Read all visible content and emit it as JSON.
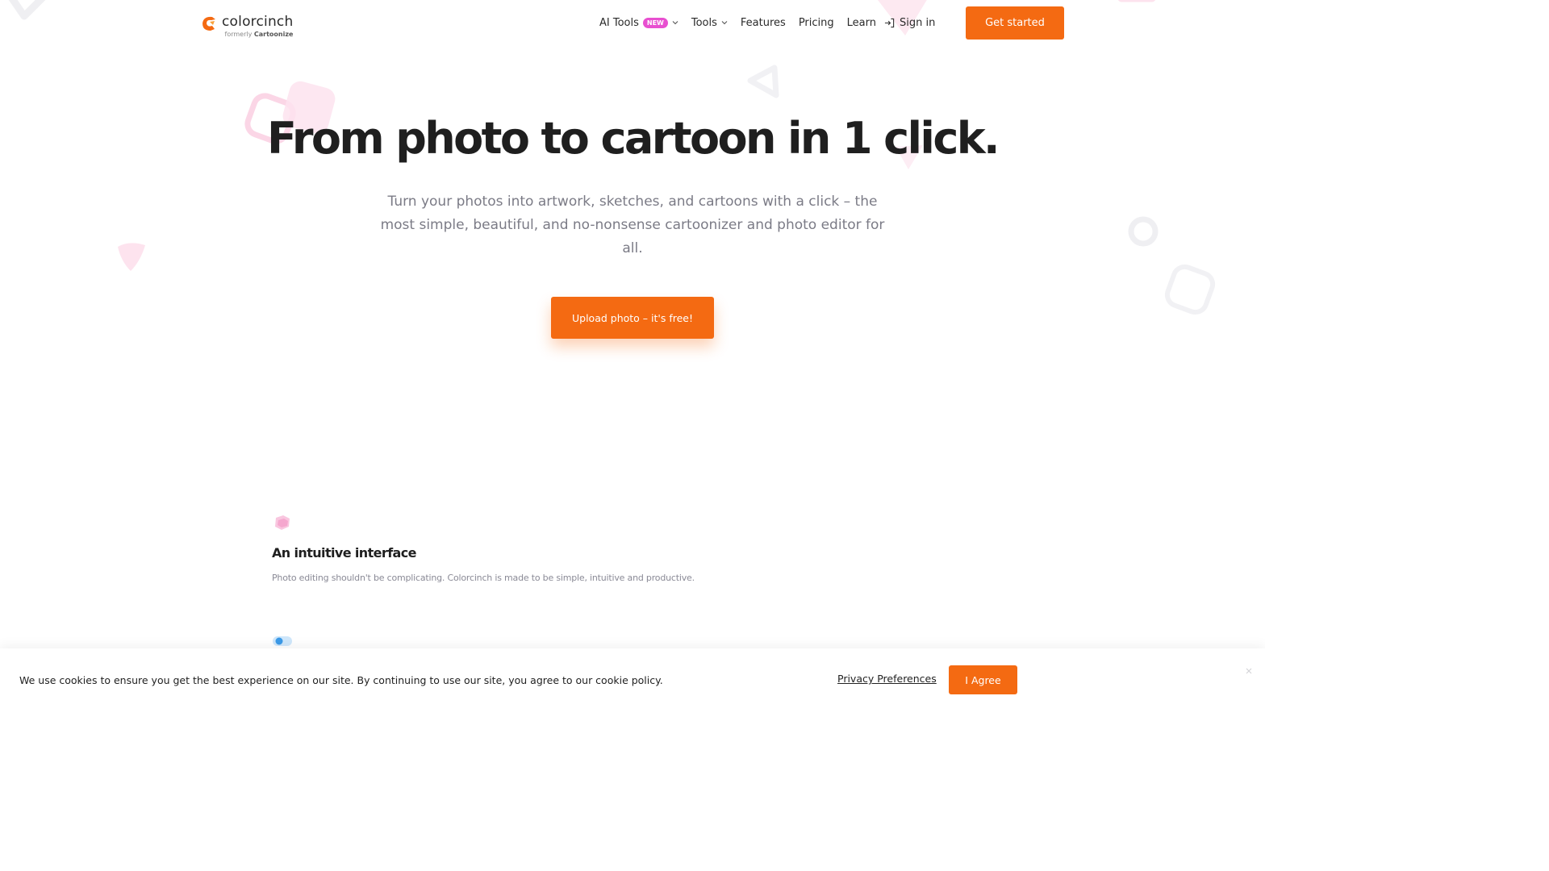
{
  "header": {
    "logo_name": "colorcinch",
    "logo_sub_prefix": "formerly",
    "logo_sub_brand": "Cartoonize",
    "nav": [
      {
        "label": "AI Tools",
        "badge": "NEW",
        "dropdown": true
      },
      {
        "label": "Tools",
        "dropdown": true
      },
      {
        "label": "Features"
      },
      {
        "label": "Pricing"
      },
      {
        "label": "Learn"
      }
    ],
    "signin_label": "Sign in",
    "cta_label": "Get started"
  },
  "hero": {
    "title": "From photo to cartoon in 1 click.",
    "subtitle": "Turn your photos into artwork, sketches, and cartoons with a click – the most simple, beautiful, and no-nonsense cartoonizer and photo editor for all.",
    "cta_label": "Upload photo – it's free!"
  },
  "features": [
    {
      "icon": "pink-cube-icon",
      "title": "An intuitive interface",
      "text": "Photo editing shouldn't be complicating. Colorcinch is made to be simple, intuitive and productive."
    },
    {
      "icon": "blue-toggle-icon"
    }
  ],
  "cookie": {
    "text": "We use cookies to ensure you get the best experience on our site. By continuing to use our site, you agree to our cookie policy.",
    "privacy_label": "Privacy Preferences",
    "agree_label": "I Agree"
  },
  "colors": {
    "accent": "#f46a12",
    "badge": "#e84fd0",
    "heading": "#1f1f1f",
    "muted": "#7b7b86"
  }
}
